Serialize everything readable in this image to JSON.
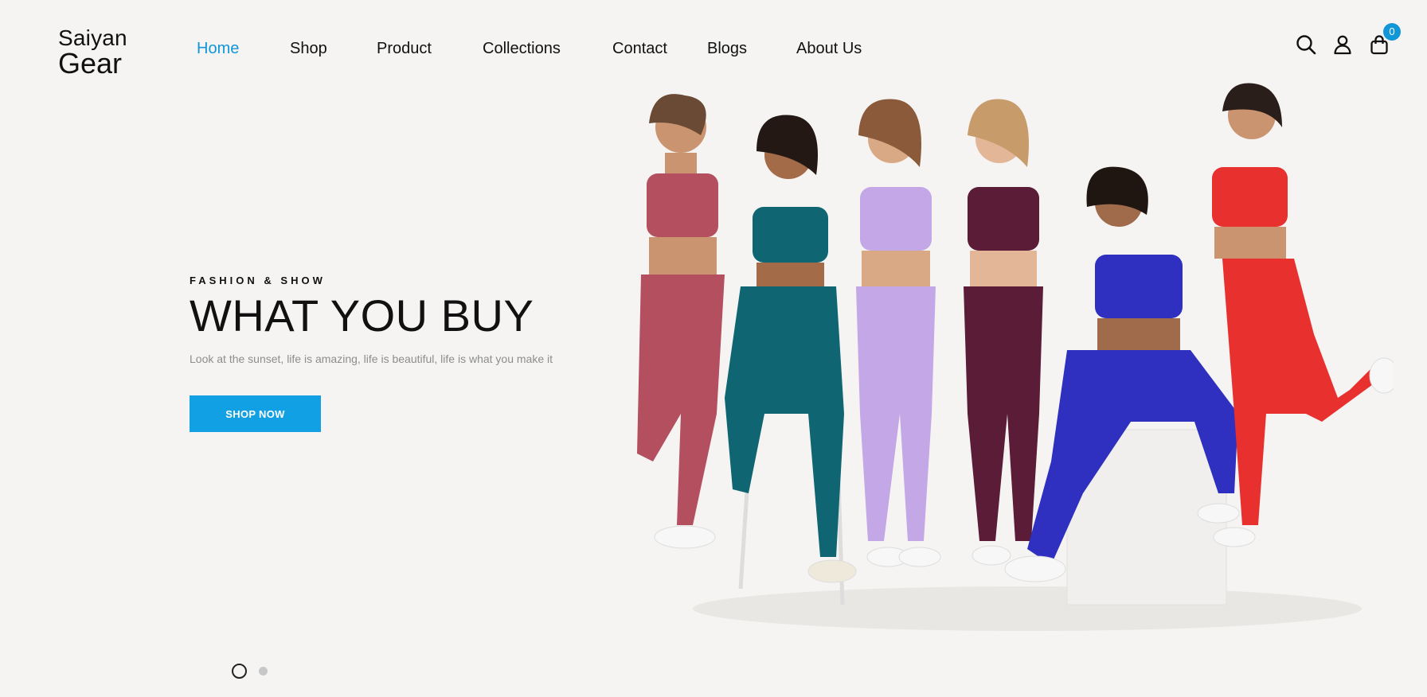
{
  "brand": {
    "line1": "Saiyan",
    "line2": "Gear"
  },
  "nav": {
    "items": [
      {
        "label": "Home",
        "active": true
      },
      {
        "label": "Shop"
      },
      {
        "label": "Product"
      },
      {
        "label": "Collections"
      },
      {
        "label": "Contact"
      },
      {
        "label": "Blogs"
      },
      {
        "label": "About Us"
      }
    ]
  },
  "header_icons": [
    "search-icon",
    "user-icon",
    "shopping-bag-icon"
  ],
  "cart": {
    "count": "0"
  },
  "hero": {
    "eyebrow": "FASHION & SHOW",
    "headline": "WHAT YOU BUY",
    "tagline": "Look at the sunset, life is amazing, life is beautiful, life is what you make it",
    "cta_label": "SHOP NOW"
  },
  "slider": {
    "total": 2,
    "current": 1
  },
  "colors": {
    "accent": "#11a0e3",
    "active_nav": "#1196d8",
    "background": "#f5f4f2",
    "outfits": [
      "#b34f5e",
      "#0f6672",
      "#c3a7e7",
      "#5a1c36",
      "#2f2fc0",
      "#e8312f"
    ]
  }
}
